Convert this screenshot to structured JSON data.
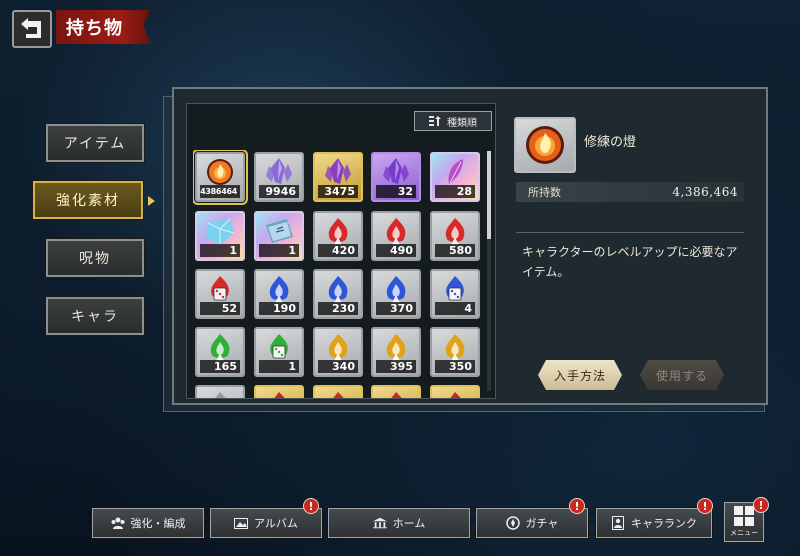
{
  "header": {
    "title": "持ち物",
    "back_icon": "back-arrow-icon"
  },
  "side_tabs": [
    {
      "label": "アイテム",
      "active": false
    },
    {
      "label": "強化素材",
      "active": true
    },
    {
      "label": "呪物",
      "active": false
    },
    {
      "label": "キャラ",
      "active": false
    }
  ],
  "sort_button": {
    "label": "種類順",
    "icon": "sort-icon"
  },
  "grid_items": [
    {
      "count": "4386464",
      "bg": "gray",
      "icon": "flame-orb-icon",
      "color": "#f07a20",
      "selected": true
    },
    {
      "count": "9946",
      "bg": "gray",
      "icon": "purple-crystal-icon",
      "color": "#8a6ad8"
    },
    {
      "count": "3475",
      "bg": "gold",
      "icon": "purple-crystal-icon",
      "color": "#8a3fc2"
    },
    {
      "count": "32",
      "bg": "purple",
      "icon": "purple-crystal-icon",
      "color": "#7a3ad0"
    },
    {
      "count": "28",
      "bg": "rainbow",
      "icon": "feather-icon",
      "color": "#b84fc8"
    },
    {
      "count": "1",
      "bg": "rainbow",
      "icon": "rainbow-gem-icon",
      "color": "#7ad3ee"
    },
    {
      "count": "1",
      "bg": "rainbow",
      "icon": "book-icon",
      "color": "#6aa6c8"
    },
    {
      "count": "420",
      "bg": "gray",
      "icon": "flame-shard-icon",
      "color": "#d62a2a"
    },
    {
      "count": "490",
      "bg": "gray",
      "icon": "flame-shard-icon",
      "color": "#d62a2a"
    },
    {
      "count": "580",
      "bg": "gray",
      "icon": "flame-shard-icon",
      "color": "#d62a2a"
    },
    {
      "count": "52",
      "bg": "gray",
      "icon": "dice-flame-icon",
      "color": "#d62a2a"
    },
    {
      "count": "190",
      "bg": "gray",
      "icon": "flame-shard-icon",
      "color": "#2f55d8"
    },
    {
      "count": "230",
      "bg": "gray",
      "icon": "flame-shard-icon",
      "color": "#2f55d8"
    },
    {
      "count": "370",
      "bg": "gray",
      "icon": "flame-shard-icon",
      "color": "#2f55d8"
    },
    {
      "count": "4",
      "bg": "gray",
      "icon": "dice-flame-icon",
      "color": "#2f55d8"
    },
    {
      "count": "165",
      "bg": "gray",
      "icon": "flame-shard-icon",
      "color": "#2fae3a"
    },
    {
      "count": "1",
      "bg": "gray",
      "icon": "dice-flame-icon",
      "color": "#2fae3a"
    },
    {
      "count": "340",
      "bg": "gray",
      "icon": "flame-shard-icon",
      "color": "#e0a21a"
    },
    {
      "count": "395",
      "bg": "gray",
      "icon": "flame-shard-icon",
      "color": "#e0a21a"
    },
    {
      "count": "350",
      "bg": "gray",
      "icon": "flame-shard-icon",
      "color": "#e0a21a"
    },
    {
      "count": "",
      "bg": "gray",
      "icon": "flame-shard-icon",
      "color": "#999999"
    },
    {
      "count": "",
      "bg": "gold",
      "icon": "flame-shard-icon",
      "color": "#c22a2a"
    },
    {
      "count": "",
      "bg": "gold",
      "icon": "flame-shard-icon",
      "color": "#c22a2a"
    },
    {
      "count": "",
      "bg": "gold",
      "icon": "flame-shard-icon",
      "color": "#c22a2a"
    },
    {
      "count": "",
      "bg": "gold",
      "icon": "flame-shard-icon",
      "color": "#c22a2a"
    }
  ],
  "detail": {
    "name": "修練の燈",
    "owned_label": "所持数",
    "owned_value": "4,386,464",
    "description": "キャラクターのレベルアップに必要なアイテム。",
    "acquire_label": "入手方法",
    "use_label": "使用する"
  },
  "bottom_nav": [
    {
      "label": "強化・編成",
      "icon": "group-icon",
      "badge": false
    },
    {
      "label": "アルバム",
      "icon": "album-icon",
      "badge": true
    },
    {
      "label": "ホーム",
      "icon": "home-icon",
      "badge": false
    },
    {
      "label": "ガチャ",
      "icon": "gacha-icon",
      "badge": true
    },
    {
      "label": "キャラランク",
      "icon": "rank-icon",
      "badge": true
    }
  ],
  "menu": {
    "label": "メニュー",
    "icon": "grid-menu-icon",
    "badge": true,
    "badge_text": "!"
  },
  "colors": {
    "accent_gold": "#e3c04a",
    "banner_red": "#9b1c15",
    "badge_red": "#c8281e"
  }
}
